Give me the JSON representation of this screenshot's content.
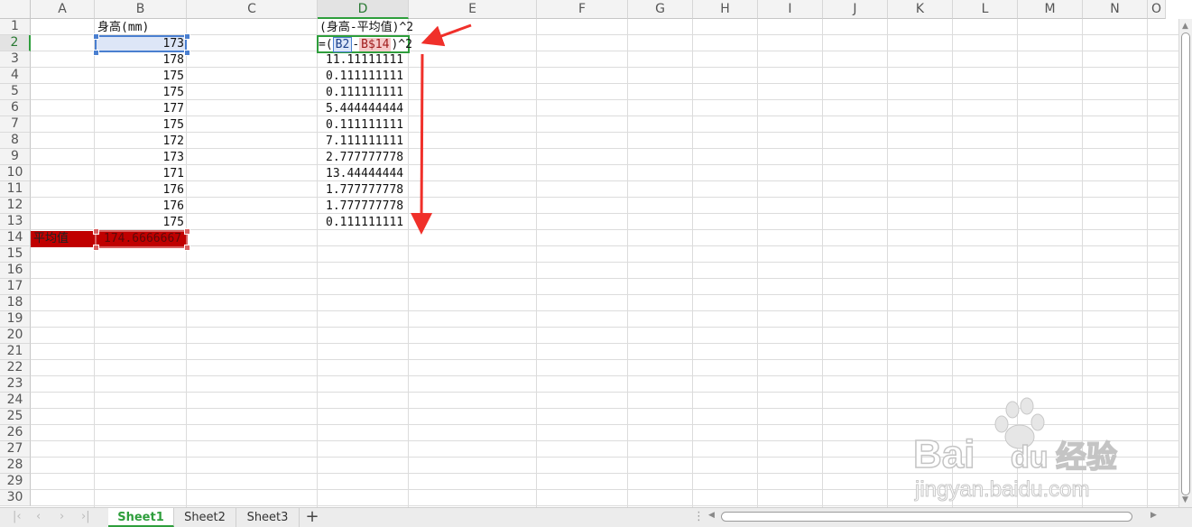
{
  "columns": [
    "A",
    "B",
    "C",
    "D",
    "E",
    "F",
    "G",
    "H",
    "I",
    "J",
    "K",
    "L",
    "M",
    "N",
    "O"
  ],
  "rows": [
    "1",
    "2",
    "3",
    "4",
    "5",
    "6",
    "7",
    "8",
    "9",
    "10",
    "11",
    "12",
    "13",
    "14",
    "15",
    "16",
    "17",
    "18",
    "19",
    "20",
    "21",
    "22",
    "23",
    "24",
    "25",
    "26",
    "27",
    "28",
    "29",
    "30"
  ],
  "active_column": "D",
  "active_row": "2",
  "cells": {
    "B1": "身高(mm)",
    "D1": "(身高-平均值)^2",
    "B_values": [
      "173",
      "178",
      "175",
      "175",
      "177",
      "175",
      "172",
      "173",
      "171",
      "176",
      "176",
      "175"
    ],
    "D_values": [
      "11.11111111",
      "0.111111111",
      "0.111111111",
      "5.444444444",
      "0.111111111",
      "7.111111111",
      "2.777777778",
      "13.44444444",
      "1.777777778",
      "1.777777778",
      "0.111111111"
    ],
    "A14": "平均值",
    "B14": "174.6666667"
  },
  "formula": {
    "prefix": "=(",
    "ref1": "B2",
    "minus": "-",
    "ref2": "B$14",
    "suffix": ")^2"
  },
  "sheet_tabs": [
    "Sheet1",
    "Sheet2",
    "Sheet3"
  ],
  "active_tab": "Sheet1",
  "add_tab_label": "+",
  "watermark": {
    "brand": "Bai",
    "brand2": "du",
    "product": "经验",
    "url": "jingyan.baidu.com"
  },
  "colors": {
    "accent_green": "#2e9e3c",
    "selection_blue": "#4a7fd0",
    "highlight_red": "#c00000",
    "arrow_red": "#f0302a"
  }
}
